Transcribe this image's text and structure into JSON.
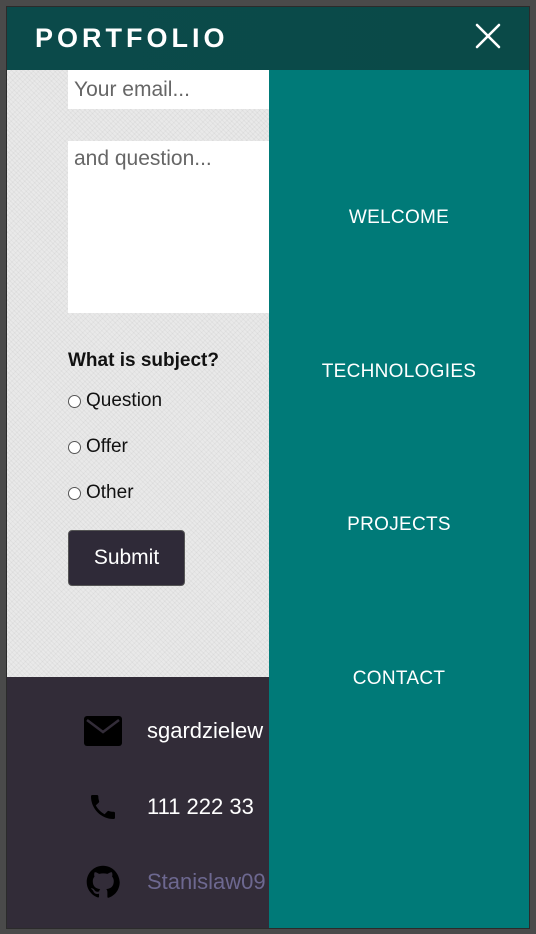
{
  "header": {
    "brand": "PORTFOLIO"
  },
  "form": {
    "email_placeholder": "Your email...",
    "question_placeholder": "and question...",
    "subject_heading": "What is subject?",
    "options": [
      {
        "label": "Question",
        "selected": false
      },
      {
        "label": "Offer",
        "selected": false
      },
      {
        "label": "Other",
        "selected": false
      }
    ],
    "submit_label": "Submit"
  },
  "footer": {
    "email": "sgardzielew",
    "phone": "111 222 33",
    "github": "Stanislaw09"
  },
  "menu": {
    "items": [
      {
        "label": "WELCOME"
      },
      {
        "label": "TECHNOLOGIES"
      },
      {
        "label": "PROJECTS"
      },
      {
        "label": "CONTACT"
      }
    ]
  },
  "icons": {
    "close": "close-icon",
    "email": "envelope-icon",
    "phone": "phone-icon",
    "github": "github-icon"
  },
  "colors": {
    "header": "#0b4a4a",
    "drawer": "#007a78",
    "footer": "#322c38",
    "submit": "#2f2a38",
    "link": "#6d6890"
  }
}
